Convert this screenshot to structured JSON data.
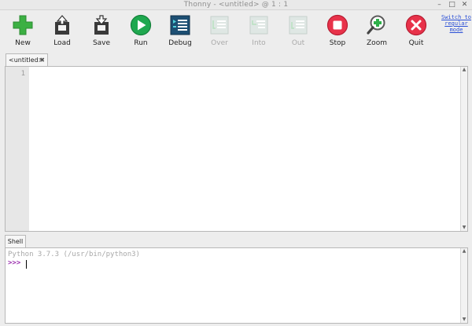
{
  "window": {
    "title": "Thonny  -  <untitled>  @  1 : 1",
    "controls": {
      "minimize": "–",
      "maximize": "□",
      "close": "✕"
    }
  },
  "toolbar": {
    "new_label": "New",
    "load_label": "Load",
    "save_label": "Save",
    "run_label": "Run",
    "debug_label": "Debug",
    "over_label": "Over",
    "into_label": "Into",
    "out_label": "Out",
    "stop_label": "Stop",
    "zoom_label": "Zoom",
    "quit_label": "Quit",
    "switch_link": "Switch to regular mode"
  },
  "editor": {
    "tab_label": "<untitled>",
    "tab_close": "✖",
    "line_numbers": [
      "1"
    ],
    "content": ""
  },
  "shell": {
    "tab_label": "Shell",
    "output_line": "Python 3.7.3 (/usr/bin/python3)",
    "prompt": ">>>"
  },
  "colors": {
    "accent_green": "#3cb043",
    "run_green": "#1fa84f",
    "stop_red": "#e8324a",
    "link_blue": "#2a4fd6",
    "prompt_purple": "#9b2fae"
  }
}
